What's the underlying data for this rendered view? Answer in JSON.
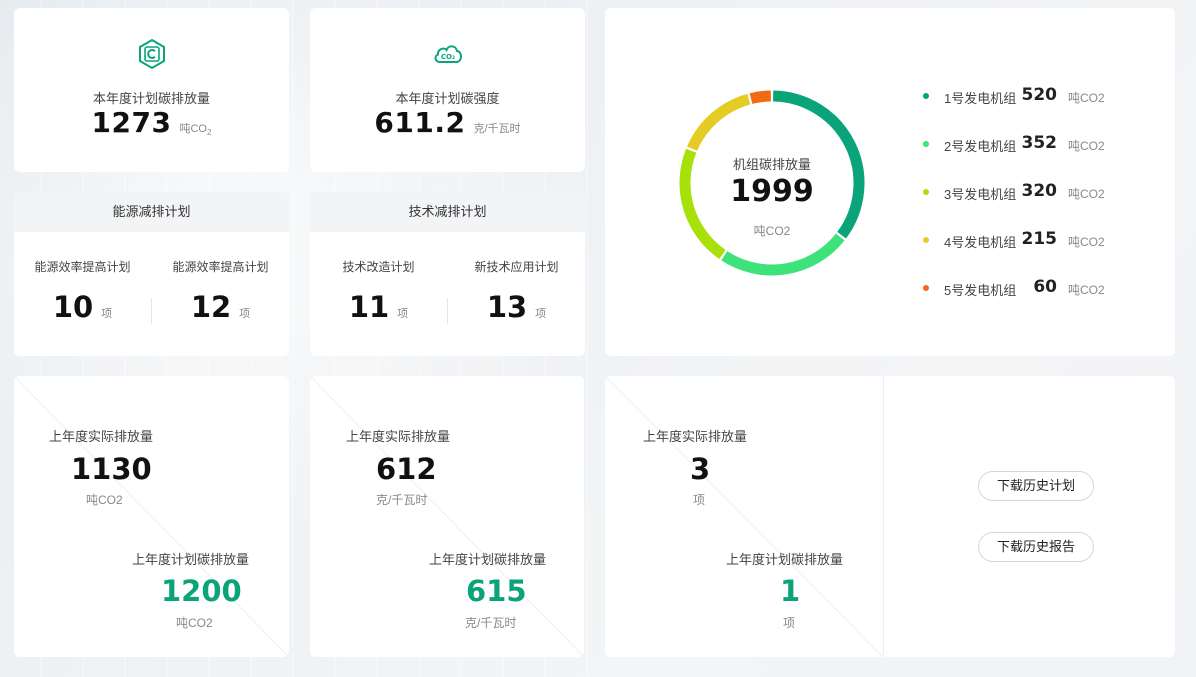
{
  "colors": {
    "accent": "#0aa37a",
    "unit_gray": "#888888"
  },
  "kpi_intensity": {
    "icon": "carbon-c-icon",
    "title": "本年度计划碳排放量",
    "value": "1273",
    "unit_main": "吨CO",
    "unit_sub": "2"
  },
  "kpi_strength": {
    "icon": "co2-cloud-icon",
    "title": "本年度计划碳强度",
    "value": "611.2",
    "unit": "克/千瓦时"
  },
  "energy_plan": {
    "title": "能源减排计划",
    "items": [
      {
        "label": "能源效率提高计划",
        "value": "10",
        "unit": "项"
      },
      {
        "label": "能源效率提高计划",
        "value": "12",
        "unit": "项"
      }
    ]
  },
  "tech_plan": {
    "title": "技术减排计划",
    "items": [
      {
        "label": "技术改造计划",
        "value": "11",
        "unit": "项"
      },
      {
        "label": "新技术应用计划",
        "value": "13",
        "unit": "项"
      }
    ]
  },
  "unit_emission": {
    "center_title": "机组碳排放量",
    "center_value": "1999",
    "center_unit": "吨CO2",
    "chart_data": {
      "type": "pie",
      "categories": [
        "1号发电机组",
        "2号发电机组",
        "3号发电机组",
        "4号发电机组",
        "5号发电机组"
      ],
      "values": [
        520,
        352,
        320,
        215,
        60
      ],
      "colors": [
        "#0aa37a",
        "#3ee27a",
        "#a8e00a",
        "#e5cc24",
        "#f06c12"
      ],
      "unit": "吨CO2",
      "donut": true,
      "legend": "right"
    }
  },
  "last_year_emission": {
    "actual_title": "上年度实际排放量",
    "actual_value": "1130",
    "actual_unit": "吨CO2",
    "plan_title": "上年度计划碳排放量",
    "plan_value": "1200",
    "plan_unit": "吨CO2"
  },
  "last_year_strength": {
    "actual_title": "上年度实际排放量",
    "actual_value": "612",
    "actual_unit": "克/千瓦时",
    "plan_title": "上年度计划碳排放量",
    "plan_value": "615",
    "plan_unit": "克/千瓦时"
  },
  "last_year_items": {
    "actual_title": "上年度实际排放量",
    "actual_value": "3",
    "actual_unit": "项",
    "plan_title": "上年度计划碳排放量",
    "plan_value": "1",
    "plan_unit": "项"
  },
  "downloads": {
    "history_plan": "下载历史计划",
    "history_report": "下载历史报告"
  }
}
